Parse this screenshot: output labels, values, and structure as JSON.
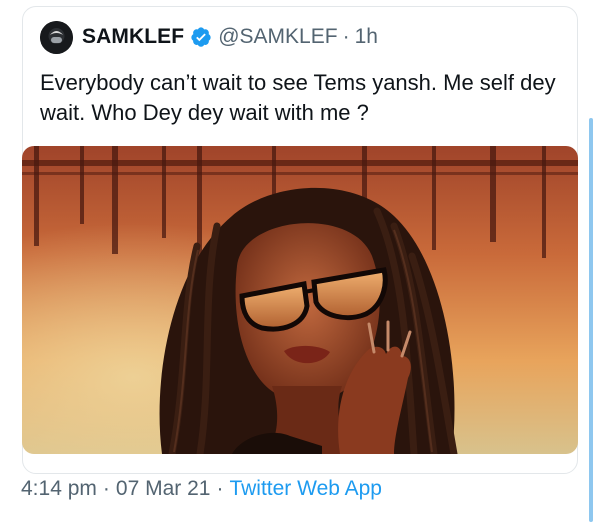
{
  "tweet": {
    "author_name": "SAMKLEF",
    "handle": "@SAMKLEF",
    "separator": "·",
    "age": "1h",
    "verified": true,
    "text": "Everybody can’t wait to see Tems yansh. Me self dey wait. Who Dey dey wait with me ?",
    "media": {
      "kind": "photo"
    },
    "footer": {
      "time": "4:14 pm",
      "date": "07 Mar 21",
      "source": "Twitter Web App",
      "separator": "·"
    }
  },
  "colors": {
    "accent": "#1d9bf0",
    "muted_text": "#536471",
    "primary_text": "#0f1419",
    "scroll_accent": "#8ec7ef"
  },
  "icons": {
    "avatar": "avatar-icon",
    "verified": "verified-badge-icon"
  }
}
